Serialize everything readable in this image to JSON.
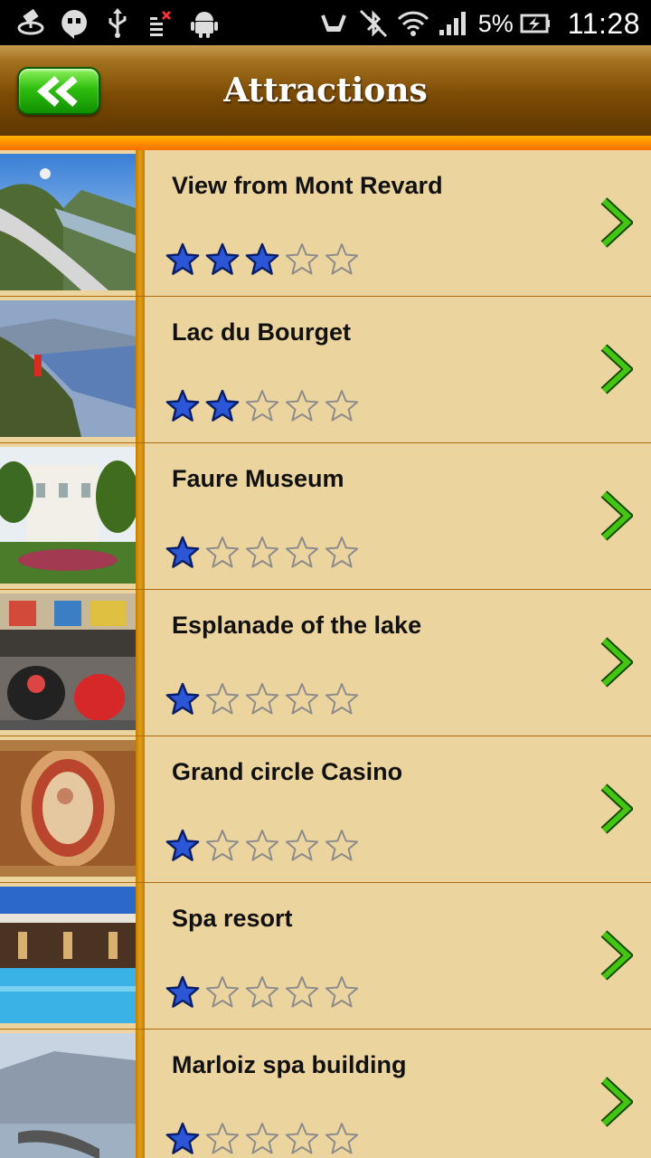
{
  "status_bar": {
    "battery_percent": "5%",
    "clock": "11:28",
    "left_icons": [
      "gps-icon",
      "hangouts-icon",
      "usb-icon",
      "sim-error-icon",
      "android-icon"
    ],
    "right_icons": [
      "vibrate-icon",
      "bluetooth-off-icon",
      "wifi-icon",
      "signal-icon",
      "battery-charging-icon"
    ]
  },
  "header": {
    "title": "Attractions",
    "back_icon": "double-chevron-left-icon"
  },
  "colors": {
    "accent_green": "#1fb000",
    "star_filled": "#2b57d6",
    "row_background": "#ecd49f",
    "header_brown": "#6a3f04"
  },
  "attractions": [
    {
      "title": "View from Mont Revard",
      "rating": 3,
      "max_rating": 5
    },
    {
      "title": "Lac du Bourget",
      "rating": 2,
      "max_rating": 5
    },
    {
      "title": "Faure Museum",
      "rating": 1,
      "max_rating": 5
    },
    {
      "title": "Esplanade of the lake",
      "rating": 1,
      "max_rating": 5
    },
    {
      "title": "Grand circle Casino",
      "rating": 1,
      "max_rating": 5
    },
    {
      "title": "Spa resort",
      "rating": 1,
      "max_rating": 5
    },
    {
      "title": "Marloiz spa building",
      "rating": 1,
      "max_rating": 5
    }
  ]
}
